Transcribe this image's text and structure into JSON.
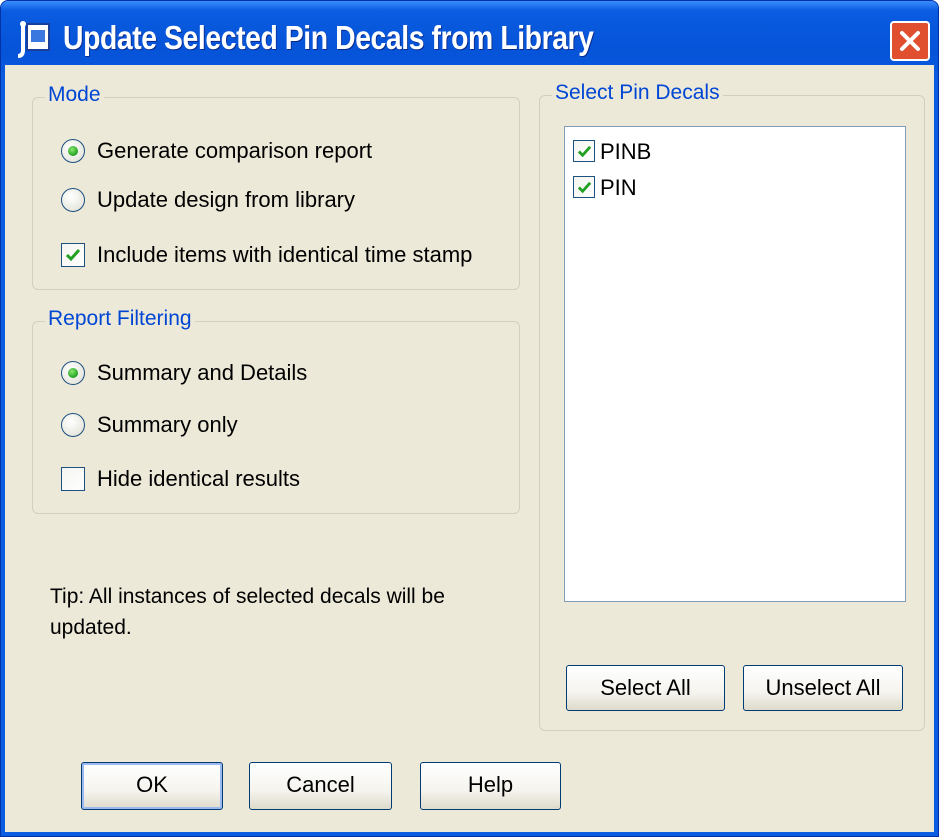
{
  "window": {
    "title": "Update Selected Pin Decals from Library",
    "icon": "pin-decal-app-icon",
    "close_icon": "close-icon"
  },
  "mode": {
    "legend": "Mode",
    "options": [
      {
        "label": "Generate comparison report",
        "selected": true
      },
      {
        "label": "Update design from library",
        "selected": false
      }
    ],
    "include_identical": {
      "label": "Include items with identical time stamp",
      "checked": true
    }
  },
  "report_filtering": {
    "legend": "Report Filtering",
    "options": [
      {
        "label": "Summary and Details",
        "selected": true
      },
      {
        "label": "Summary only",
        "selected": false
      }
    ],
    "hide_identical": {
      "label": "Hide identical results",
      "checked": false
    }
  },
  "tip": {
    "text": "Tip: All instances of selected decals will be updated."
  },
  "select_pin_decals": {
    "legend": "Select Pin Decals",
    "items": [
      {
        "label": "PINB",
        "checked": true
      },
      {
        "label": "PIN",
        "checked": true
      }
    ],
    "select_all_label": "Select All",
    "unselect_all_label": "Unselect All"
  },
  "footer": {
    "ok_label": "OK",
    "cancel_label": "Cancel",
    "help_label": "Help"
  },
  "colors": {
    "title_bar": "#0a5ce0",
    "dialog_bg": "#ece9d8",
    "group_label": "#0046d5",
    "check_mark": "#21a121",
    "close_button": "#e0502e"
  }
}
